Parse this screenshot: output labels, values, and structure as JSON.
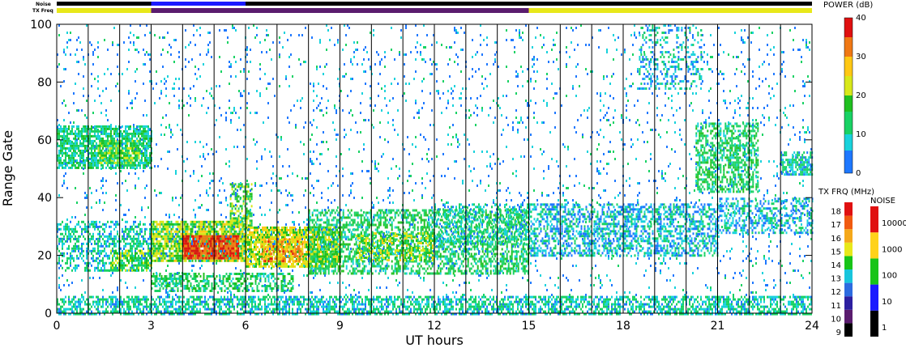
{
  "chart_data": {
    "type": "heatmap",
    "title": "",
    "xlabel": "UT hours",
    "ylabel": "Range Gate",
    "xlim": [
      0,
      24
    ],
    "ylim": [
      0,
      100
    ],
    "x_ticks": [
      "0",
      "3",
      "6",
      "9",
      "12",
      "15",
      "18",
      "21",
      "24"
    ],
    "y_ticks": [
      "0",
      "20",
      "40",
      "60",
      "80",
      "100"
    ],
    "top_bar_labels": {
      "noise": "Noise",
      "txfreq": "TX Freq"
    },
    "power_scale": {
      "label": "POWER (dB)",
      "range": [
        0,
        40
      ],
      "ticks": [
        "0",
        "10",
        "20",
        "30",
        "40"
      ]
    },
    "txfreq_scale": {
      "label": "TX FRQ (MHz)",
      "ticks": [
        "9",
        "10",
        "11",
        "12",
        "13",
        "14",
        "15",
        "16",
        "17",
        "18"
      ],
      "colors": [
        "#000000",
        "#5a1c6e",
        "#2d1fa0",
        "#2d6be0",
        "#19c5dc",
        "#18c418",
        "#e8e81a",
        "#f5a81a",
        "#f05a10",
        "#e01010"
      ]
    },
    "noise_scale": {
      "label": "NOISE",
      "ticks": [
        "1",
        "10",
        "100",
        "1000",
        "10000"
      ],
      "colors": [
        "#000000",
        "#1a1aff",
        "#18c418",
        "#ffd21a",
        "#e01010"
      ]
    },
    "scan_boundaries_ut": [
      1,
      2,
      3,
      4,
      5,
      6,
      7,
      8,
      9,
      10,
      11,
      12,
      13,
      14,
      15,
      16,
      17,
      18,
      19,
      20,
      21,
      22,
      23
    ],
    "txfreq_segments": [
      {
        "start": 0,
        "end": 3,
        "mhz": 15
      },
      {
        "start": 3,
        "end": 15,
        "mhz": 10
      },
      {
        "start": 15,
        "end": 24,
        "mhz": 15
      }
    ],
    "noise_segments": [
      {
        "start": 0,
        "end": 3,
        "level": "1"
      },
      {
        "start": 3,
        "end": 6,
        "level": "10"
      },
      {
        "start": 6,
        "end": 24,
        "level": "1"
      }
    ],
    "echo_regions": [
      {
        "t0": 0,
        "t1": 3,
        "g0": 50,
        "g1": 65,
        "shape": "band",
        "power": 12,
        "density": 0.75
      },
      {
        "t0": 1.3,
        "t1": 2.6,
        "g0": 52,
        "g1": 60,
        "shape": "band",
        "power": 18,
        "density": 0.6
      },
      {
        "t0": 0,
        "t1": 3,
        "g0": 15,
        "g1": 32,
        "shape": "band",
        "power": 10,
        "density": 0.45
      },
      {
        "t0": 1.7,
        "t1": 3,
        "g0": 15,
        "g1": 22,
        "shape": "band",
        "power": 18,
        "density": 0.5
      },
      {
        "t0": 3,
        "t1": 6,
        "g0": 18,
        "g1": 32,
        "shape": "band",
        "power": 20,
        "density": 0.85
      },
      {
        "t0": 4,
        "t1": 5.8,
        "g0": 19,
        "g1": 27,
        "shape": "band",
        "power": 36,
        "density": 0.9
      },
      {
        "t0": 3,
        "t1": 7.5,
        "g0": 8,
        "g1": 14,
        "shape": "band",
        "power": 14,
        "density": 0.55
      },
      {
        "t0": 5.5,
        "t1": 6.2,
        "g0": 30,
        "g1": 45,
        "shape": "band",
        "power": 18,
        "density": 0.55
      },
      {
        "t0": 6,
        "t1": 9,
        "g0": 16,
        "g1": 30,
        "shape": "band",
        "power": 22,
        "density": 0.8
      },
      {
        "t0": 6.5,
        "t1": 7.8,
        "g0": 18,
        "g1": 26,
        "shape": "band",
        "power": 30,
        "density": 0.6
      },
      {
        "t0": 8,
        "t1": 15,
        "g0": 14,
        "g1": 36,
        "shape": "band",
        "power": 14,
        "density": 0.5
      },
      {
        "t0": 9.5,
        "t1": 12,
        "g0": 18,
        "g1": 28,
        "shape": "band",
        "power": 20,
        "density": 0.45
      },
      {
        "t0": 12,
        "t1": 15,
        "g0": 24,
        "g1": 38,
        "shape": "band",
        "power": 10,
        "density": 0.35
      },
      {
        "t0": 15,
        "t1": 21,
        "g0": 20,
        "g1": 38,
        "shape": "band",
        "power": 8,
        "density": 0.5
      },
      {
        "t0": 21,
        "t1": 24,
        "g0": 28,
        "g1": 40,
        "shape": "band",
        "power": 8,
        "density": 0.45
      },
      {
        "t0": 20.3,
        "t1": 22.3,
        "g0": 42,
        "g1": 66,
        "shape": "band",
        "power": 14,
        "density": 0.55
      },
      {
        "t0": 23,
        "t1": 24,
        "g0": 48,
        "g1": 56,
        "shape": "band",
        "power": 10,
        "density": 0.65
      },
      {
        "t0": 0,
        "t1": 24,
        "g0": 0,
        "g1": 6,
        "shape": "band",
        "power": 10,
        "density": 0.6
      },
      {
        "t0": 0,
        "t1": 24,
        "g0": 6,
        "g1": 100,
        "shape": "scatter",
        "power": 6,
        "density": 0.05
      },
      {
        "t0": 18.5,
        "t1": 20.5,
        "g0": 78,
        "g1": 100,
        "shape": "scatter",
        "power": 8,
        "density": 0.25
      }
    ]
  }
}
